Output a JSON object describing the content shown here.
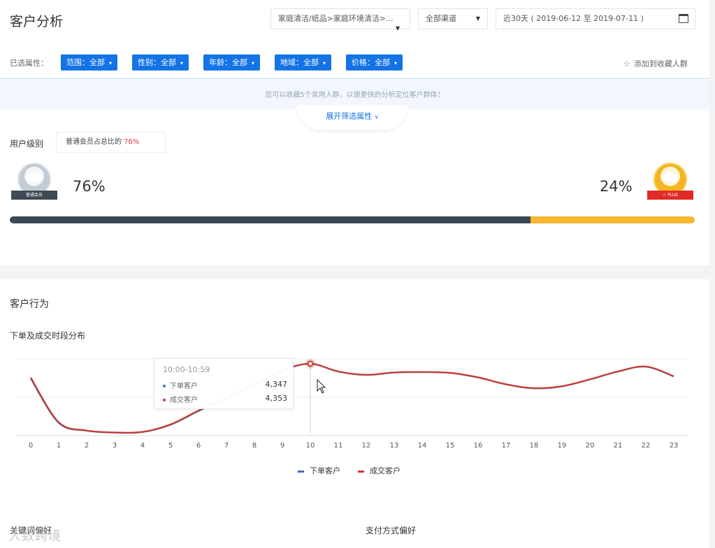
{
  "header": {
    "title": "客户分析",
    "category_select": "家庭清洁/纸品>家庭环境清洁>...",
    "channel_select": "全部渠道",
    "date_range": "近30天 ( 2019-06-12 至 2019-07-11 )"
  },
  "filters": {
    "label": "已选属性：",
    "chips": [
      "范围：全部",
      "性别：全部",
      "年龄：全部",
      "地域：全部",
      "价格：全部"
    ],
    "add_favorite": "添加到收藏人群"
  },
  "tip": {
    "text": "您可以收藏5个常用人群，以便更快的分析定位客户群体！",
    "expand": "展开筛选属性"
  },
  "user_level": {
    "label": "用户级别",
    "summary_prefix": "普通会员占总比的",
    "summary_value": "76%",
    "normal_badge": "普通会员",
    "plus_badge": "PLUS",
    "normal_pct": "76%",
    "plus_pct": "24%",
    "normal_share": 0.76,
    "plus_share": 0.24
  },
  "behavior": {
    "section_title": "客户行为",
    "chart_title": "下单及成交时段分布",
    "tooltip": {
      "title": "10:00-10:59",
      "rows": [
        {
          "name": "下单客户",
          "value": "4,347"
        },
        {
          "name": "成交客户",
          "value": "4,353"
        }
      ]
    },
    "legend": [
      "下单客户",
      "成交客户"
    ]
  },
  "bottom": {
    "left_title": "关键词偏好",
    "right_title": "支付方式偏好"
  },
  "watermark": "人数跨境",
  "colors": {
    "primary": "#1473e6",
    "order_series": "#3f6fb6",
    "deal_series": "#c83a32",
    "plus_bar": "#f7b72e",
    "normal_bar": "#3b4856"
  },
  "chart_data": {
    "type": "line",
    "x": [
      0,
      1,
      2,
      3,
      4,
      5,
      6,
      7,
      8,
      9,
      10,
      11,
      12,
      13,
      14,
      15,
      16,
      17,
      18,
      19,
      20,
      21,
      22,
      23
    ],
    "series": [
      {
        "name": "下单客户",
        "values": [
          3600,
          1350,
          950,
          850,
          880,
          1250,
          1950,
          2600,
          3300,
          4000,
          4347,
          3950,
          3780,
          3900,
          3920,
          3880,
          3650,
          3300,
          3100,
          3200,
          3550,
          3950,
          4200,
          3700
        ]
      },
      {
        "name": "成交客户",
        "values": [
          3650,
          1380,
          960,
          860,
          890,
          1270,
          1970,
          2620,
          3320,
          4020,
          4353,
          3960,
          3790,
          3910,
          3930,
          3890,
          3660,
          3310,
          3110,
          3210,
          3560,
          3960,
          4210,
          3720
        ]
      }
    ],
    "ylim": [
      700,
      4600
    ],
    "grid": true,
    "highlight_x": 10
  }
}
